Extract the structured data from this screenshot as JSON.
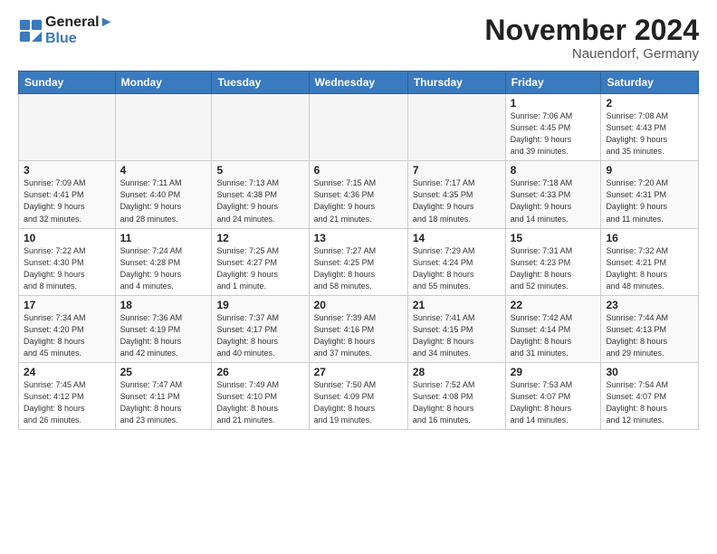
{
  "header": {
    "logo_line1": "General",
    "logo_line2": "Blue",
    "month_title": "November 2024",
    "location": "Nauendorf, Germany"
  },
  "weekdays": [
    "Sunday",
    "Monday",
    "Tuesday",
    "Wednesday",
    "Thursday",
    "Friday",
    "Saturday"
  ],
  "weeks": [
    [
      {
        "day": "",
        "info": ""
      },
      {
        "day": "",
        "info": ""
      },
      {
        "day": "",
        "info": ""
      },
      {
        "day": "",
        "info": ""
      },
      {
        "day": "",
        "info": ""
      },
      {
        "day": "1",
        "info": "Sunrise: 7:06 AM\nSunset: 4:45 PM\nDaylight: 9 hours\nand 39 minutes."
      },
      {
        "day": "2",
        "info": "Sunrise: 7:08 AM\nSunset: 4:43 PM\nDaylight: 9 hours\nand 35 minutes."
      }
    ],
    [
      {
        "day": "3",
        "info": "Sunrise: 7:09 AM\nSunset: 4:41 PM\nDaylight: 9 hours\nand 32 minutes."
      },
      {
        "day": "4",
        "info": "Sunrise: 7:11 AM\nSunset: 4:40 PM\nDaylight: 9 hours\nand 28 minutes."
      },
      {
        "day": "5",
        "info": "Sunrise: 7:13 AM\nSunset: 4:38 PM\nDaylight: 9 hours\nand 24 minutes."
      },
      {
        "day": "6",
        "info": "Sunrise: 7:15 AM\nSunset: 4:36 PM\nDaylight: 9 hours\nand 21 minutes."
      },
      {
        "day": "7",
        "info": "Sunrise: 7:17 AM\nSunset: 4:35 PM\nDaylight: 9 hours\nand 18 minutes."
      },
      {
        "day": "8",
        "info": "Sunrise: 7:18 AM\nSunset: 4:33 PM\nDaylight: 9 hours\nand 14 minutes."
      },
      {
        "day": "9",
        "info": "Sunrise: 7:20 AM\nSunset: 4:31 PM\nDaylight: 9 hours\nand 11 minutes."
      }
    ],
    [
      {
        "day": "10",
        "info": "Sunrise: 7:22 AM\nSunset: 4:30 PM\nDaylight: 9 hours\nand 8 minutes."
      },
      {
        "day": "11",
        "info": "Sunrise: 7:24 AM\nSunset: 4:28 PM\nDaylight: 9 hours\nand 4 minutes."
      },
      {
        "day": "12",
        "info": "Sunrise: 7:25 AM\nSunset: 4:27 PM\nDaylight: 9 hours\nand 1 minute."
      },
      {
        "day": "13",
        "info": "Sunrise: 7:27 AM\nSunset: 4:25 PM\nDaylight: 8 hours\nand 58 minutes."
      },
      {
        "day": "14",
        "info": "Sunrise: 7:29 AM\nSunset: 4:24 PM\nDaylight: 8 hours\nand 55 minutes."
      },
      {
        "day": "15",
        "info": "Sunrise: 7:31 AM\nSunset: 4:23 PM\nDaylight: 8 hours\nand 52 minutes."
      },
      {
        "day": "16",
        "info": "Sunrise: 7:32 AM\nSunset: 4:21 PM\nDaylight: 8 hours\nand 48 minutes."
      }
    ],
    [
      {
        "day": "17",
        "info": "Sunrise: 7:34 AM\nSunset: 4:20 PM\nDaylight: 8 hours\nand 45 minutes."
      },
      {
        "day": "18",
        "info": "Sunrise: 7:36 AM\nSunset: 4:19 PM\nDaylight: 8 hours\nand 42 minutes."
      },
      {
        "day": "19",
        "info": "Sunrise: 7:37 AM\nSunset: 4:17 PM\nDaylight: 8 hours\nand 40 minutes."
      },
      {
        "day": "20",
        "info": "Sunrise: 7:39 AM\nSunset: 4:16 PM\nDaylight: 8 hours\nand 37 minutes."
      },
      {
        "day": "21",
        "info": "Sunrise: 7:41 AM\nSunset: 4:15 PM\nDaylight: 8 hours\nand 34 minutes."
      },
      {
        "day": "22",
        "info": "Sunrise: 7:42 AM\nSunset: 4:14 PM\nDaylight: 8 hours\nand 31 minutes."
      },
      {
        "day": "23",
        "info": "Sunrise: 7:44 AM\nSunset: 4:13 PM\nDaylight: 8 hours\nand 29 minutes."
      }
    ],
    [
      {
        "day": "24",
        "info": "Sunrise: 7:45 AM\nSunset: 4:12 PM\nDaylight: 8 hours\nand 26 minutes."
      },
      {
        "day": "25",
        "info": "Sunrise: 7:47 AM\nSunset: 4:11 PM\nDaylight: 8 hours\nand 23 minutes."
      },
      {
        "day": "26",
        "info": "Sunrise: 7:49 AM\nSunset: 4:10 PM\nDaylight: 8 hours\nand 21 minutes."
      },
      {
        "day": "27",
        "info": "Sunrise: 7:50 AM\nSunset: 4:09 PM\nDaylight: 8 hours\nand 19 minutes."
      },
      {
        "day": "28",
        "info": "Sunrise: 7:52 AM\nSunset: 4:08 PM\nDaylight: 8 hours\nand 16 minutes."
      },
      {
        "day": "29",
        "info": "Sunrise: 7:53 AM\nSunset: 4:07 PM\nDaylight: 8 hours\nand 14 minutes."
      },
      {
        "day": "30",
        "info": "Sunrise: 7:54 AM\nSunset: 4:07 PM\nDaylight: 8 hours\nand 12 minutes."
      }
    ]
  ]
}
